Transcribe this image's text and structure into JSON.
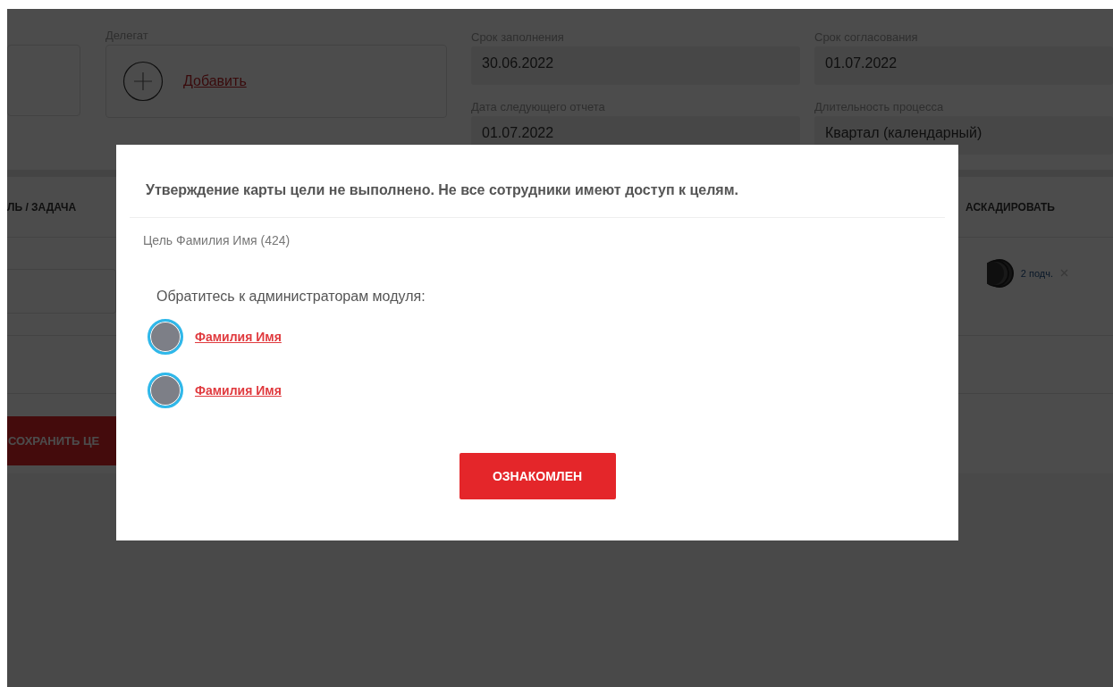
{
  "form": {
    "delegate": {
      "label": "Делегат",
      "add_link": "Добавить"
    },
    "date_columns": [
      [
        {
          "label": "Срок заполнения",
          "value": "30.06.2022"
        },
        {
          "label": "Дата следующего отчета",
          "value": "01.07.2022"
        }
      ],
      [
        {
          "label": "Срок согласования",
          "value": "01.07.2022"
        },
        {
          "label": "Длительность процесса",
          "value": "Квартал (календарный)"
        }
      ]
    ]
  },
  "table": {
    "columns": [
      "ЛЬ / ЗАДАЧА",
      "АСКАДИРОВАТЬ"
    ],
    "rows": [
      {
        "subordinates": "2 подч."
      }
    ]
  },
  "save_button": "СОХРАНИТЬ ЦЕ",
  "dialog": {
    "title": "Утверждение карты цели не выполнено. Не все сотрудники имеют доступ к целям.",
    "goal": "Цель Фамилия Имя (424)",
    "prompt": "Обратитесь к администраторам модуля:",
    "admins": [
      {
        "name": "Фамилия Имя"
      },
      {
        "name": "Фамилия Имя"
      }
    ],
    "button": "ОЗНАКОМЛЕН"
  }
}
